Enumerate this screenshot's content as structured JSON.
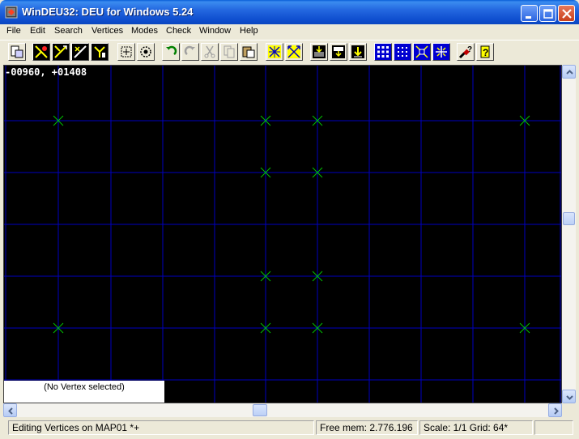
{
  "window": {
    "title": "WinDEU32: DEU for Windows 5.24",
    "minimize_icon": "minimize-icon",
    "maximize_icon": "maximize-icon",
    "close_icon": "close-icon"
  },
  "menu": {
    "items": [
      "File",
      "Edit",
      "Search",
      "Vertices",
      "Modes",
      "Check",
      "Window",
      "Help"
    ]
  },
  "toolbar": {
    "buttons": [
      "clipboard-icon",
      "things-mode-icon",
      "linedefs-mode-icon",
      "vertices-mode-icon",
      "sectors-mode-icon",
      "select-box-icon",
      "gear-icon",
      "undo-icon",
      "redo-icon",
      "cut-icon",
      "copy-icon",
      "paste-icon",
      "center-icon",
      "zoom-out-icon",
      "download-icon",
      "save-icon",
      "import-icon",
      "grid-small-icon",
      "grid-large-icon",
      "zoom-fit-icon",
      "zoom-in-icon",
      "context-help-icon",
      "help-icon"
    ]
  },
  "canvas": {
    "coords": "-00960, +01408",
    "background": "#000000",
    "grid_color": "#0000c0",
    "vertex_color": "#00c000",
    "vertex_count": 12
  },
  "info_panel": {
    "text": "(No Vertex selected)"
  },
  "status": {
    "mode": "Editing Vertices on MAP01 *+",
    "memory": "Free mem: 2.776.196",
    "scale": "Scale: 1/1",
    "grid": "Grid: 64*"
  }
}
